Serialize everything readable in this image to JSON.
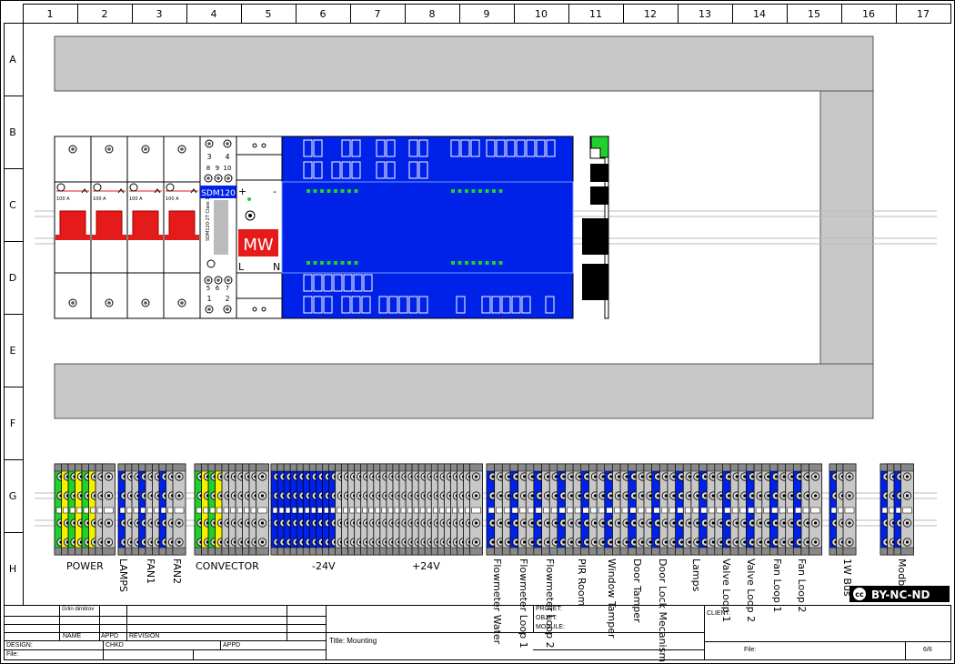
{
  "grid": {
    "columns": [
      "1",
      "2",
      "3",
      "4",
      "5",
      "6",
      "7",
      "8",
      "9",
      "10",
      "11",
      "12",
      "13",
      "14",
      "15",
      "16",
      "17"
    ],
    "rows": [
      "A",
      "B",
      "C",
      "D",
      "E",
      "F",
      "G",
      "H"
    ]
  },
  "devices": {
    "breaker_rating": "100 A",
    "meter_model": "SDM120",
    "meter_sticker": "SDM120-2T Class 1",
    "meter_terminals_top": [
      "3",
      "4"
    ],
    "meter_terminals_mid": [
      "8",
      "9",
      "10"
    ],
    "meter_terminals_bottom": [
      "5",
      "6",
      "7"
    ],
    "meter_terminals_base": [
      "1",
      "2"
    ],
    "psu_brand": "MW",
    "psu_plus": "+",
    "psu_minus": "-",
    "psu_l": "L",
    "psu_n": "N"
  },
  "terminal_labels": {
    "horizontal": [
      "POWER",
      "CONVECTOR",
      "-24V",
      "+24V"
    ],
    "vertical": [
      "LAMPS",
      "FAN1",
      "FAN2",
      "Flowmeter Water",
      "Flowmeter Loop 1",
      "Flowmeter Loop 2",
      "PIR Room",
      "Window Tamper",
      "Door Tamper",
      "Door Lock Mecanism",
      "Lamps",
      "Valve Loop 1",
      "Valve Loop 2",
      "Fan Loop 1",
      "Fan Loop 2",
      "1W Bus",
      "Modbus"
    ]
  },
  "license": "BY-NC-ND",
  "title_block": {
    "author": "Grlin dimitrov",
    "name": "NAME",
    "appd": "APPD",
    "revision": "REVISION",
    "design": "DESIGN:",
    "chkd": "CHKD",
    "appd2": "APPD",
    "file_left": "File:",
    "project": "PROJET:",
    "object": "OBJET:",
    "module": "MODULE:",
    "title": "Title: Mounting",
    "client": "CLIENT:",
    "file_right": "File:",
    "page": "6/6"
  },
  "colors": {
    "blue": "#0021e8",
    "green": "#1fd12a",
    "red": "#e51b1b",
    "gray": "#c8c8c8",
    "yellow": "#f5f000"
  }
}
